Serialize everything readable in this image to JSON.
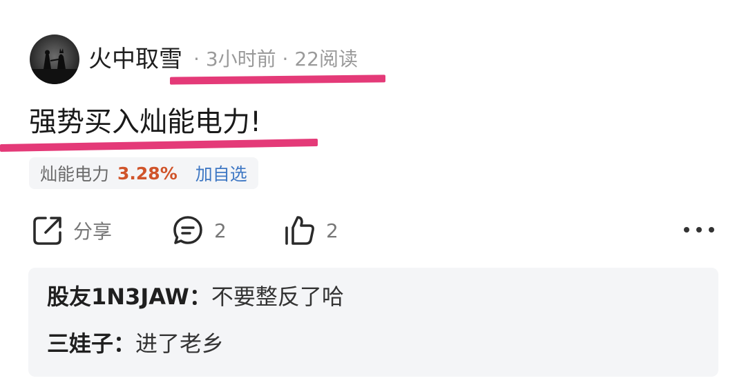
{
  "post": {
    "username": "火中取雪",
    "time": "3小时前",
    "reads": "22阅读",
    "separator": "·",
    "title": "强势买入灿能电力!"
  },
  "stock_tag": {
    "name": "灿能电力",
    "change": "3.28%",
    "add_label": "加自选",
    "change_color": "#d0542a",
    "add_color": "#3f78c4"
  },
  "actions": {
    "share_label": "分享",
    "comment_count": "2",
    "like_count": "2",
    "share_icon": "share-icon",
    "comment_icon": "comment-icon",
    "like_icon": "thumbs-up-icon",
    "more_icon": "more-dots-icon"
  },
  "comments": [
    {
      "author": "股友1N3JAW",
      "colon": "：",
      "text": "不要整反了哈"
    },
    {
      "author": "三娃子",
      "colon": "：",
      "text": "进了老乡"
    }
  ],
  "highlight_color": "#e43a78"
}
